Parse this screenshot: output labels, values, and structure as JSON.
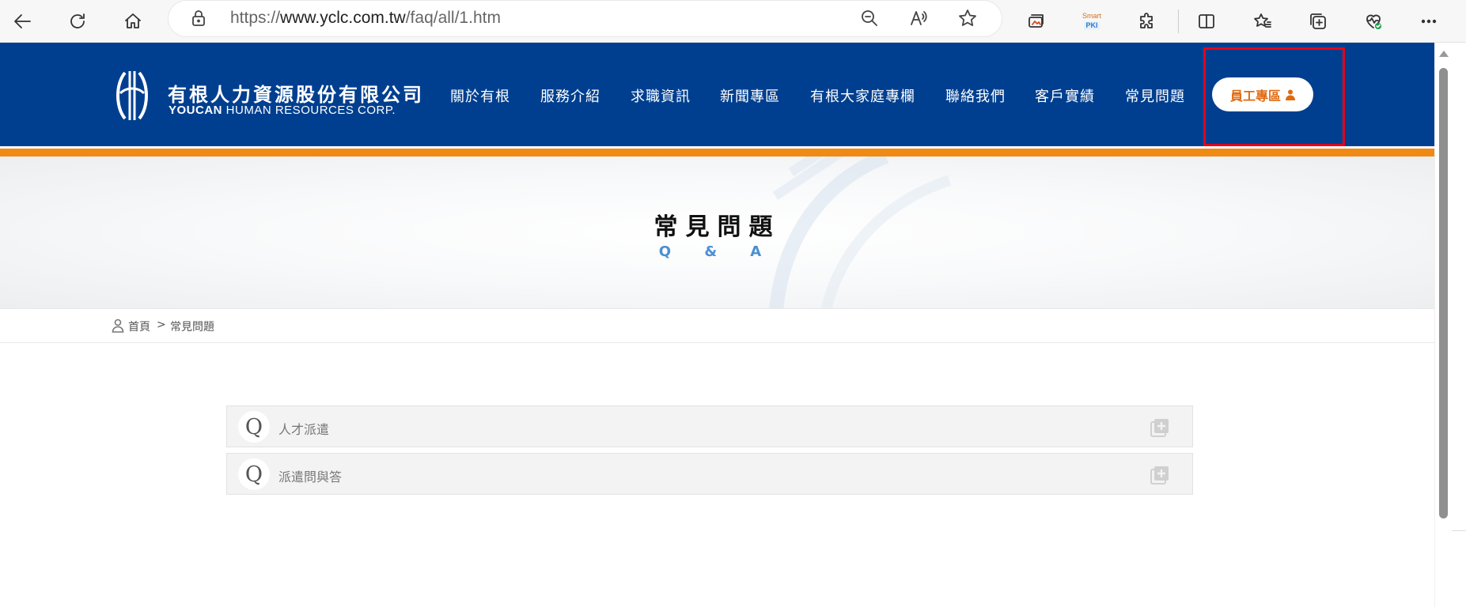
{
  "browser": {
    "url_prefix": "https://",
    "url_host": "www.yclc.com.tw",
    "url_path": "/faq/all/1.htm",
    "icons": [
      "back-arrow-icon",
      "refresh-icon",
      "home-icon",
      "lock-icon",
      "zoom-out-icon",
      "read-aloud-icon",
      "favorite-star-icon",
      "collections-icon",
      "smart-pki-icon",
      "extensions-icon",
      "split-screen-icon",
      "favorites-bar-icon",
      "add-tab-icon",
      "browser-essentials-icon",
      "more-menu-icon"
    ],
    "pki_label_top": "Smart",
    "pki_label_bottom": "PKI"
  },
  "header": {
    "logo_zh": "有根人力資源股份有限公司",
    "logo_en_bold": "YOUCAN",
    "logo_en_rest": " HUMAN RESOURCES CORP.",
    "nav": [
      {
        "label": "關於有根"
      },
      {
        "label": "服務介紹"
      },
      {
        "label": "求職資訊"
      },
      {
        "label": "新聞專區"
      },
      {
        "label": "有根大家庭專欄"
      },
      {
        "label": "聯絡我們"
      },
      {
        "label": "客戶實績"
      },
      {
        "label": "常見問題"
      }
    ],
    "staff_button": "員工專區",
    "brand_color": "#003f8f",
    "accent_color": "#f08a12"
  },
  "banner": {
    "title": "常見問題",
    "subtitle": "Q & A"
  },
  "breadcrumb": {
    "home": "首頁",
    "separator": ">",
    "current": "常見問題"
  },
  "faq": {
    "items": [
      {
        "marker": "Q",
        "label": "人才派遣"
      },
      {
        "marker": "Q",
        "label": "派遣問與答"
      }
    ]
  }
}
